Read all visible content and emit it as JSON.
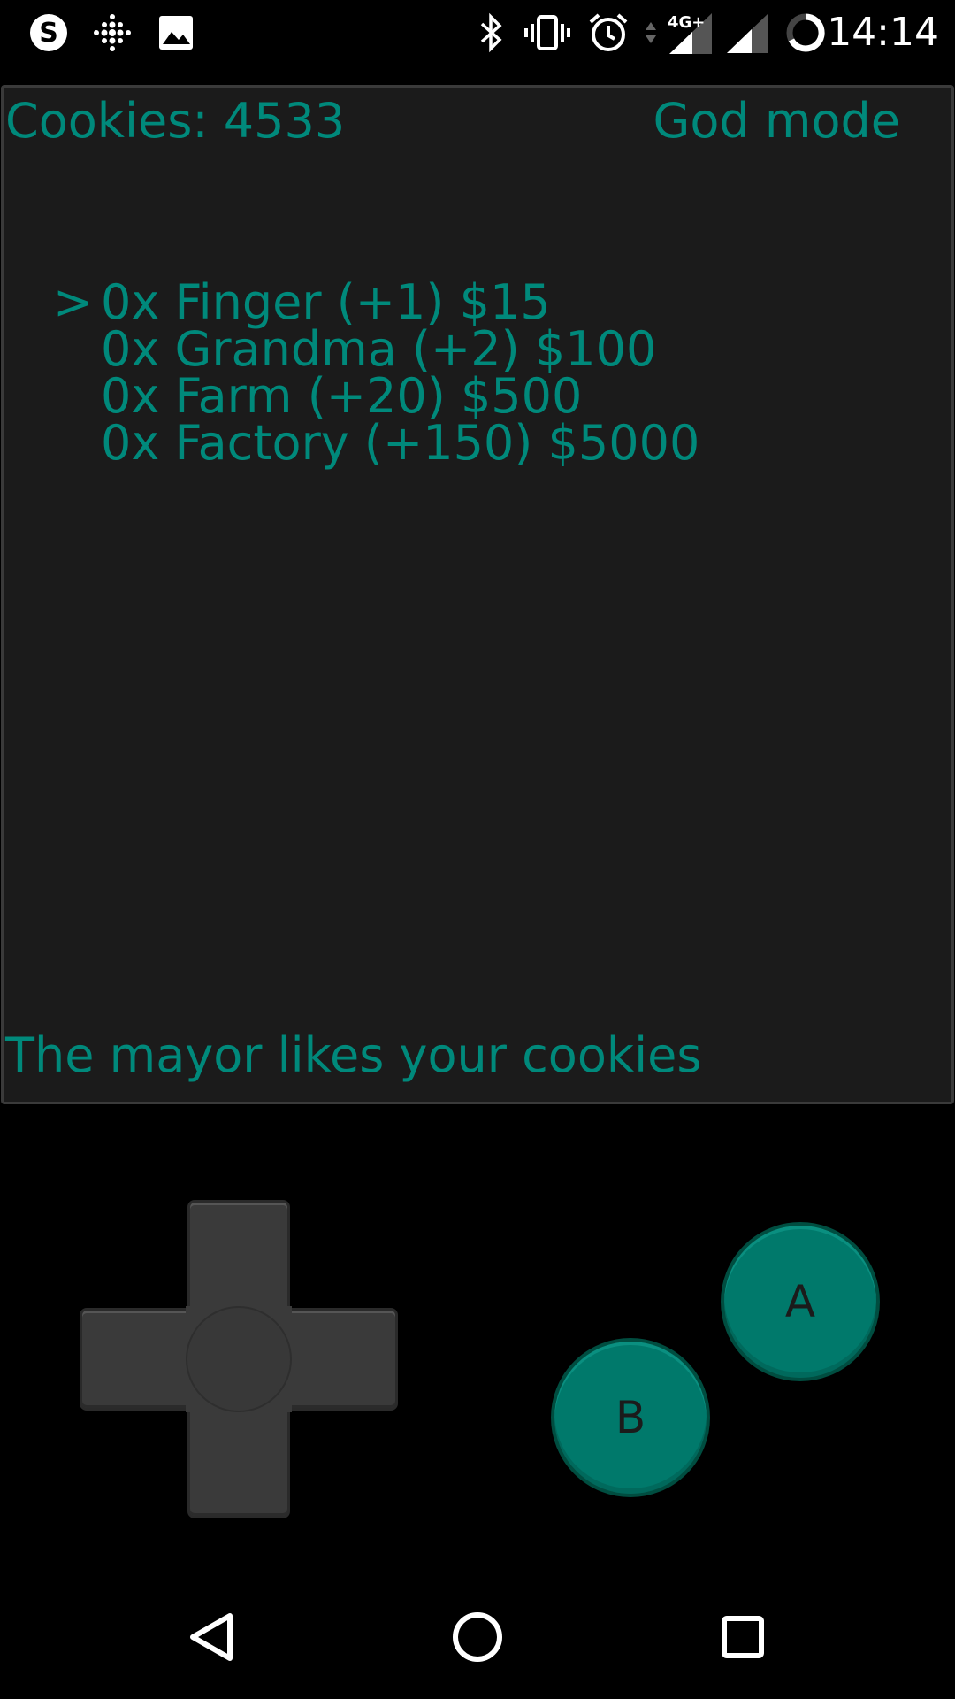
{
  "status_bar": {
    "time": "14:14",
    "network_label": "4G+",
    "left_icons": [
      "skype-icon",
      "fitbit-icon",
      "gallery-icon"
    ],
    "right_icons": [
      "bluetooth-icon",
      "vibrate-icon",
      "alarm-icon",
      "data-arrows-icon",
      "signal-4g-icon",
      "signal-icon",
      "sync-icon"
    ]
  },
  "game": {
    "score_label": "Cookies: 4533",
    "mode_label": "God mode",
    "cursor": ">",
    "menu": [
      {
        "label": "0x Finger (+1) $15",
        "selected": true
      },
      {
        "label": "0x Grandma (+2) $100",
        "selected": false
      },
      {
        "label": "0x Farm (+20) $500",
        "selected": false
      },
      {
        "label": "0x Factory (+150) $5000",
        "selected": false
      }
    ],
    "message": "The mayor likes your cookies",
    "text_color": "#00897b",
    "screen_color": "#1b1b1b"
  },
  "controller": {
    "button_a_label": "A",
    "button_b_label": "B",
    "button_color": "#00796b",
    "dpad_color": "#3a3a3a"
  },
  "nav_bar": {
    "icons": [
      "back-icon",
      "home-icon",
      "recents-icon"
    ]
  }
}
